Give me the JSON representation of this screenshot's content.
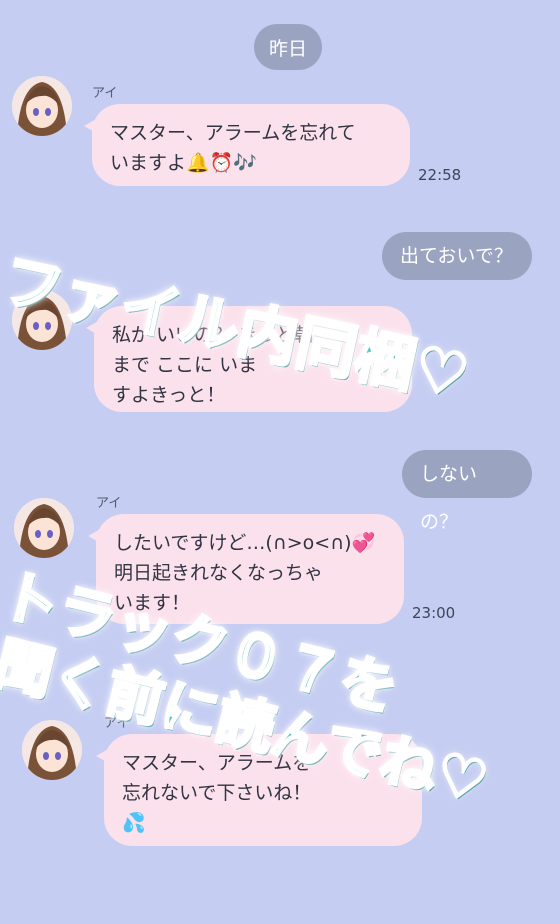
{
  "date_label": "昨日",
  "messages": [
    {
      "sender": "アイ",
      "text": "マスター、アラームを忘れて\nいますよ🔔⏰🎶",
      "time": "22:58"
    },
    {
      "text": "出ておいで？"
    },
    {
      "text": "私が いいの？ きっと朝\nまで ここに いま\nすよきっと！"
    },
    {
      "text": "しないの？"
    },
    {
      "sender": "アイ",
      "text": "したいですけど…(∩>o<∩)💞\n明日起きれなくなっちゃ\nいます！",
      "time": "23:00"
    },
    {
      "sender": "アイ",
      "text": "マスター、アラームを\n忘れないで下さいね！\n💦"
    }
  ],
  "overlays": {
    "line1": "ファイル内同梱♡",
    "line2": "トラック０７を",
    "line3": "聞く前に読んでね♡"
  },
  "colors": {
    "background": "#c5cdf2",
    "incoming_bubble": "#fbe1ec",
    "outgoing_bubble": "#9aa3bf",
    "overlay_text": "#4ec8c0"
  }
}
